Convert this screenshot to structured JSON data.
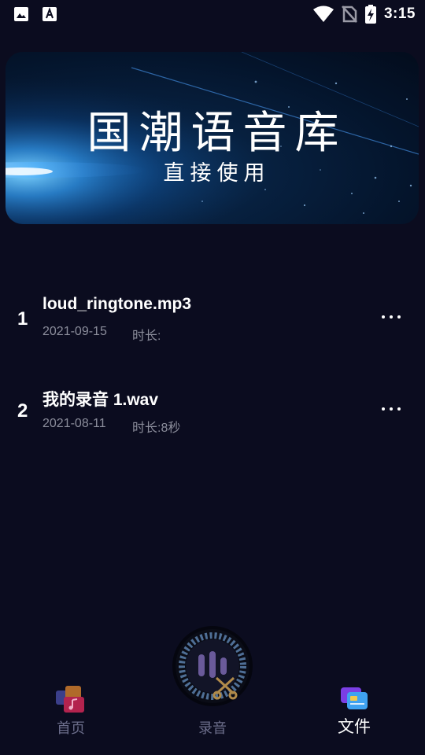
{
  "status_bar": {
    "time": "3:15",
    "icons": [
      "image-icon",
      "font-a-icon",
      "wifi-icon",
      "no-sim-icon",
      "battery-charging-icon"
    ]
  },
  "banner": {
    "title": "国潮语音库",
    "subtitle": "直接使用"
  },
  "files": [
    {
      "index": "1",
      "name": "loud_ringtone.mp3",
      "date": "2021-09-15",
      "duration_label": "时长:",
      "duration": ""
    },
    {
      "index": "2",
      "name": "我的录音 1.wav",
      "date": "2021-08-11",
      "duration_label": "时长:",
      "duration": "8秒"
    }
  ],
  "bottom_nav": {
    "home": "首页",
    "record": "录音",
    "files": "文件",
    "active": "files"
  },
  "colors": {
    "background": "#0b0c1f",
    "text_primary": "#ffffff",
    "text_secondary": "#8b8d9b",
    "nav_inactive": "#6b6d8a",
    "record_purple": "#6a5a9a",
    "record_ring": "#5b7fa8"
  }
}
